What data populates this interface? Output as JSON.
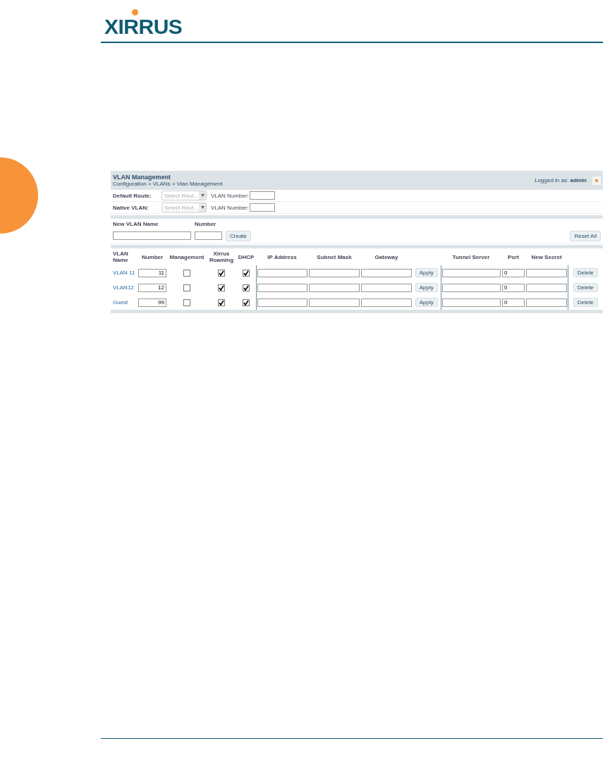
{
  "logo": {
    "text": "XIRRUS"
  },
  "panel": {
    "title": "VLAN Management",
    "breadcrumb": "Configuration > VLANs > Vlan Management",
    "logged_in_label": "Logged in as:",
    "user": "admin"
  },
  "route_rows": [
    {
      "label": "Default Route:",
      "select_placeholder": "Select Rout...",
      "number_label": "VLAN Number:"
    },
    {
      "label": "Native VLAN:",
      "select_placeholder": "Select Rout...",
      "number_label": "VLAN Number:"
    }
  ],
  "new_vlan": {
    "name_label": "New VLAN Name",
    "number_label": "Number",
    "create_button": "Create",
    "reset_button": "Reset All"
  },
  "table": {
    "columns": [
      "VLAN Name",
      "Number",
      "Management",
      "Xirrus Roaming",
      "DHCP",
      "IP Address",
      "Subnet Mask",
      "Gateway",
      "",
      "Tunnel Server",
      "Port",
      "New Secret"
    ],
    "rows": [
      {
        "name": "VLAN 11",
        "number": "11",
        "management": false,
        "roaming": true,
        "dhcp": true,
        "apply": "Apply",
        "port": "0",
        "delete": "Delete"
      },
      {
        "name": "VLAN12",
        "number": "12",
        "management": false,
        "roaming": true,
        "dhcp": true,
        "apply": "Apply",
        "port": "0",
        "delete": "Delete"
      },
      {
        "name": "Guest",
        "number": "99",
        "management": false,
        "roaming": true,
        "dhcp": true,
        "apply": "Apply",
        "port": "0",
        "delete": "Delete"
      }
    ]
  }
}
